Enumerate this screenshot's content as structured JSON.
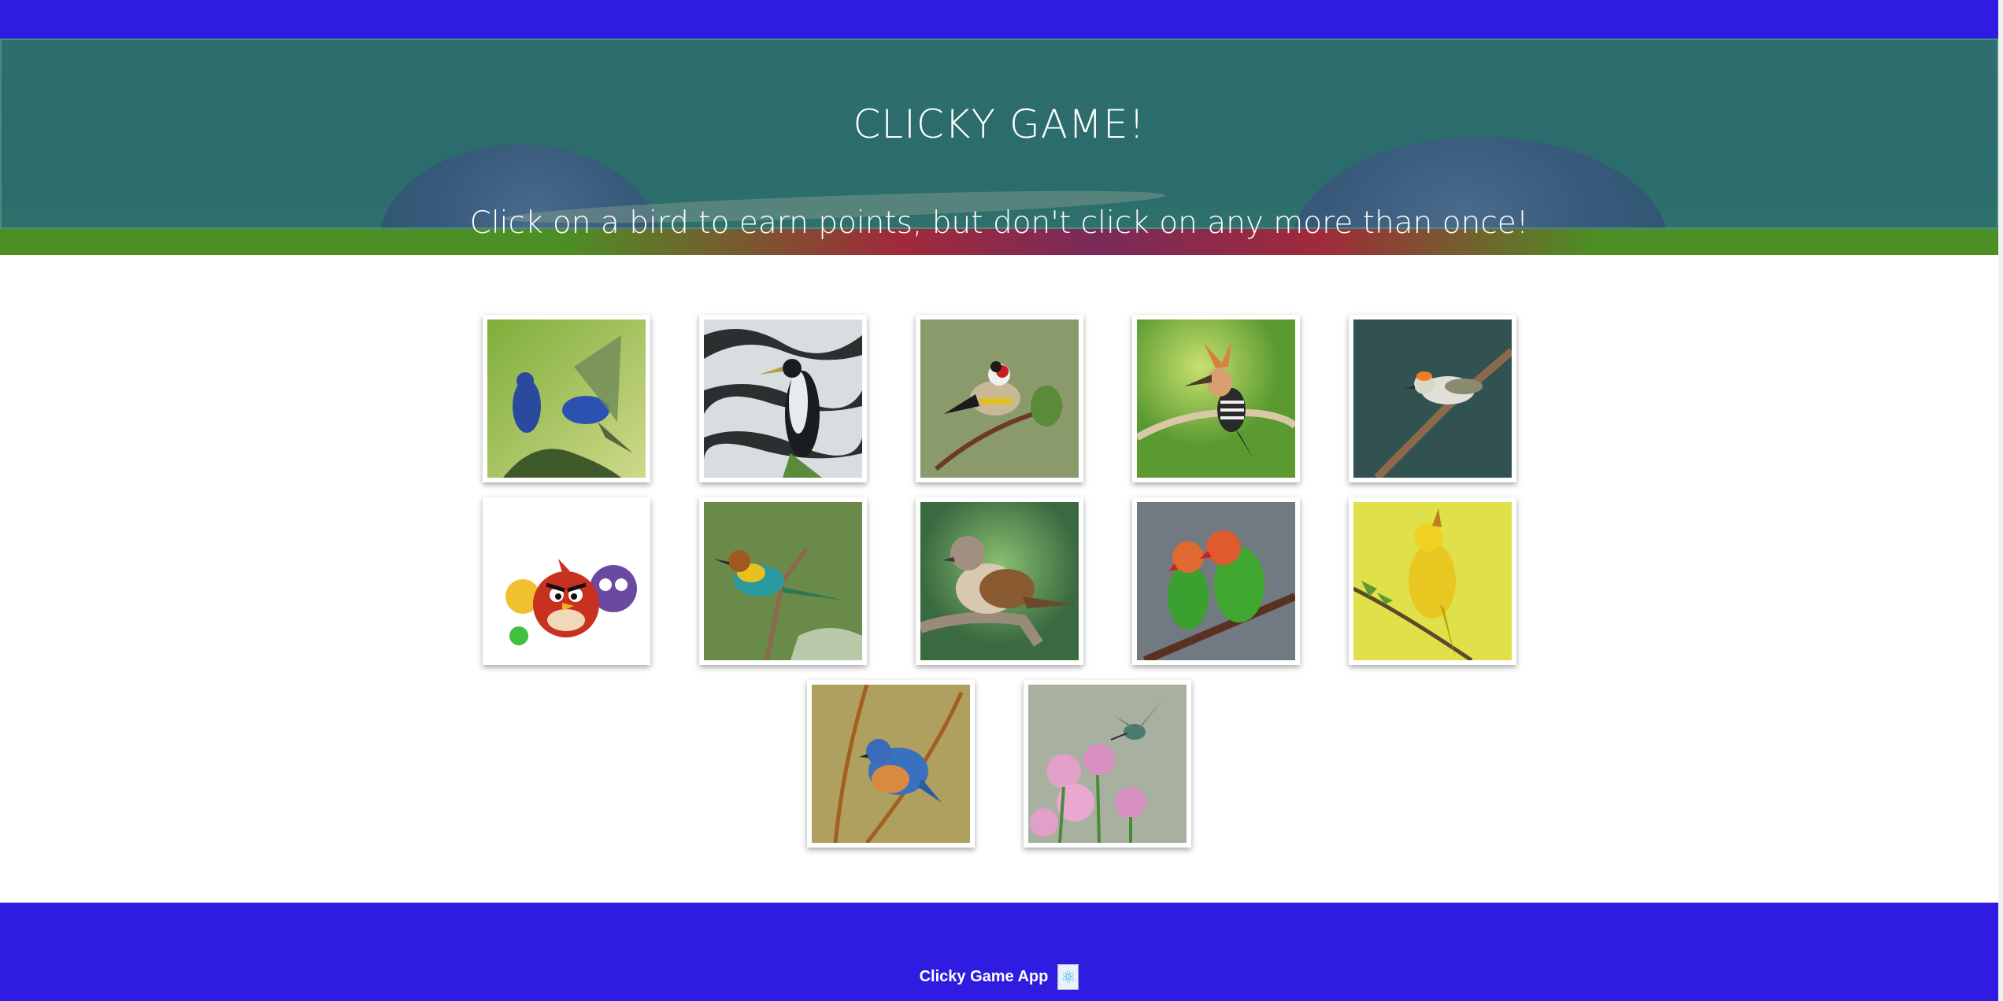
{
  "header": {
    "title": "CLICKY GAME!",
    "subtitle": "Click on a bird to earn points, but don't click on any more than once!"
  },
  "colors": {
    "nav_bg": "#2e1de0",
    "footer_bg": "#2e1de0",
    "hero_tint": "#2f6a6a"
  },
  "cards": [
    {
      "name": "indigo-buntings"
    },
    {
      "name": "black-white-bird-bark"
    },
    {
      "name": "goldfinch"
    },
    {
      "name": "hoopoe"
    },
    {
      "name": "firecrest"
    },
    {
      "name": "angry-birds"
    },
    {
      "name": "bee-eater"
    },
    {
      "name": "sparrow"
    },
    {
      "name": "lovebirds"
    },
    {
      "name": "yellow-warbler"
    },
    {
      "name": "bluebird"
    },
    {
      "name": "hummingbird-flowers"
    }
  ],
  "footer": {
    "text": "Clicky Game App",
    "icon": "react-icon"
  }
}
